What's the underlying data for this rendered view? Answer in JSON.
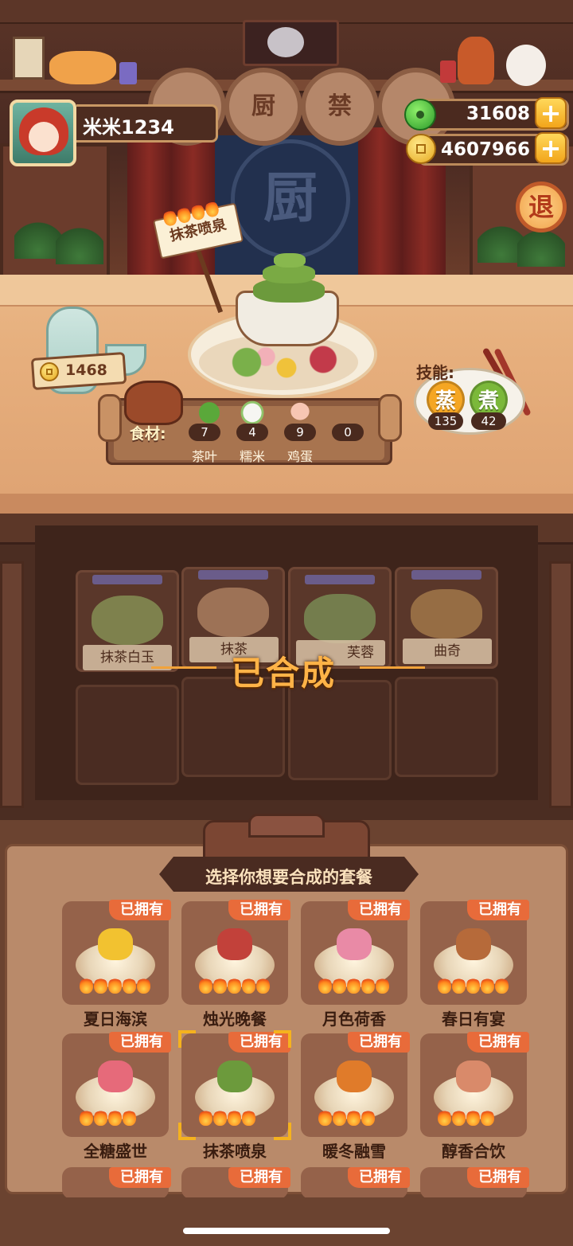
{
  "player": {
    "name": "米米1234"
  },
  "currency": {
    "jade": "31608",
    "coins": "4607966",
    "add_label": "+"
  },
  "exit_label": "退",
  "backdrop": {
    "roundel_1": "厨",
    "roundel_2": "禁",
    "logo_char": "厨"
  },
  "dish": {
    "name": "抹茶喷泉",
    "flames": 4,
    "price": "1468"
  },
  "ingredients": {
    "label": "食材:",
    "items": [
      {
        "name": "茶叶",
        "count": "7"
      },
      {
        "name": "糯米",
        "count": "4"
      },
      {
        "name": "鸡蛋",
        "count": "9"
      },
      {
        "name": "",
        "count": "0"
      }
    ]
  },
  "skills": {
    "label": "技能:",
    "items": [
      {
        "name": "蒸",
        "count": "135",
        "color": "#f5a623"
      },
      {
        "name": "煮",
        "count": "42",
        "color": "#7bb83a"
      }
    ]
  },
  "cabinet": {
    "slots": [
      "抹茶白玉",
      "抹茶",
      "芙蓉",
      "曲奇"
    ],
    "status": "已合成"
  },
  "menu": {
    "title": "选择你想要合成的套餐",
    "owned_label": "已拥有",
    "sets": [
      {
        "name": "夏日海滨",
        "flames": 5,
        "color": "#f2c230"
      },
      {
        "name": "烛光晚餐",
        "flames": 5,
        "color": "#c2413a"
      },
      {
        "name": "月色荷香",
        "flames": 5,
        "color": "#e98aa6"
      },
      {
        "name": "春日有宴",
        "flames": 5,
        "color": "#b66a3a"
      },
      {
        "name": "全糖盛世",
        "flames": 4,
        "color": "#e66a7a"
      },
      {
        "name": "抹茶喷泉",
        "flames": 4,
        "color": "#6c9a3c",
        "selected": true
      },
      {
        "name": "暖冬融雪",
        "flames": 4,
        "color": "#e07b2a"
      },
      {
        "name": "醇香合饮",
        "flames": 4,
        "color": "#d98a6a"
      }
    ]
  }
}
